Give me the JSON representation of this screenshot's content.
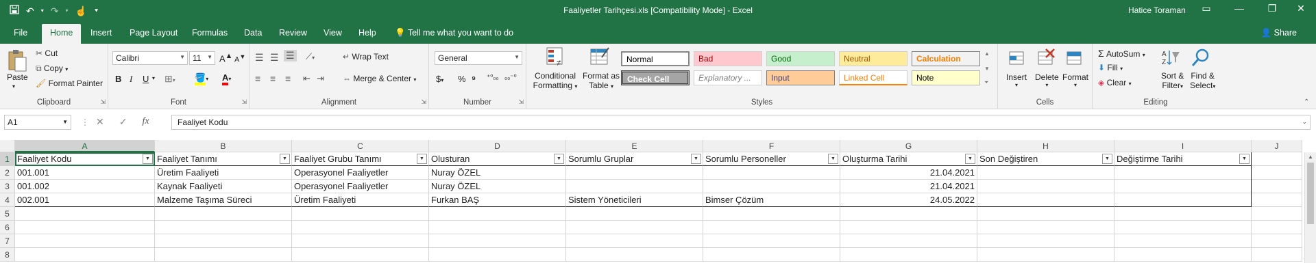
{
  "window": {
    "title": "Faaliyetler Tarihçesi.xls  [Compatibility Mode]  -  Excel",
    "user": "Hatice Toraman"
  },
  "tabs": [
    "File",
    "Home",
    "Insert",
    "Page Layout",
    "Formulas",
    "Data",
    "Review",
    "View",
    "Help"
  ],
  "tell_me": "Tell me what you want to do",
  "share": "Share",
  "clipboard": {
    "paste": "Paste",
    "cut": "Cut",
    "copy": "Copy",
    "format_painter": "Format Painter",
    "label": "Clipboard"
  },
  "font": {
    "name": "Calibri",
    "size": "11",
    "label": "Font"
  },
  "alignment": {
    "wrap": "Wrap Text",
    "merge": "Merge & Center",
    "label": "Alignment"
  },
  "number": {
    "format": "General",
    "label": "Number"
  },
  "styles": {
    "conditional": "Conditional",
    "conditional2": "Formatting",
    "format_as": "Format as",
    "format_as2": "Table",
    "label": "Styles",
    "items": [
      {
        "name": "Normal",
        "bg": "#ffffff",
        "color": "#000000"
      },
      {
        "name": "Bad",
        "bg": "#ffc7ce",
        "color": "#9c0006"
      },
      {
        "name": "Good",
        "bg": "#c6efce",
        "color": "#006100"
      },
      {
        "name": "Neutral",
        "bg": "#ffeb9c",
        "color": "#9c5700"
      },
      {
        "name": "Calculation",
        "bg": "#f2f2f2",
        "color": "#fa7d00"
      },
      {
        "name": "Check Cell",
        "bg": "#a5a5a5",
        "color": "#ffffff"
      },
      {
        "name": "Explanatory ...",
        "bg": "#ffffff",
        "color": "#7f7f7f"
      },
      {
        "name": "Input",
        "bg": "#ffcc99",
        "color": "#3f3f76"
      },
      {
        "name": "Linked Cell",
        "bg": "#ffffff",
        "color": "#fa7d00"
      },
      {
        "name": "Note",
        "bg": "#ffffcc",
        "color": "#000000"
      }
    ]
  },
  "cells_group": {
    "insert": "Insert",
    "delete": "Delete",
    "format": "Format",
    "label": "Cells"
  },
  "editing": {
    "autosum": "AutoSum",
    "fill": "Fill",
    "clear": "Clear",
    "sort": "Sort &",
    "sort2": "Filter",
    "find": "Find &",
    "find2": "Select",
    "label": "Editing"
  },
  "formula_bar": {
    "name_box": "A1",
    "value": "Faaliyet Kodu"
  },
  "columns": [
    "A",
    "B",
    "C",
    "D",
    "E",
    "F",
    "G",
    "H",
    "I",
    "J"
  ],
  "rows": [
    "1",
    "2",
    "3",
    "4",
    "5",
    "6",
    "7",
    "8"
  ],
  "table": {
    "headers": [
      "Faaliyet Kodu",
      "Faaliyet Tanımı",
      "Faaliyet Grubu Tanımı",
      "Olusturan",
      "Sorumlu Gruplar",
      "Sorumlu Personeller",
      "Oluşturma Tarihi",
      "Son Değiştiren",
      "Değiştirme Tarihi"
    ],
    "rows": [
      [
        "001.001",
        "Üretim Faaliyeti",
        "Operasyonel Faaliyetler",
        "Nuray ÖZEL",
        "",
        "",
        "21.04.2021",
        "",
        ""
      ],
      [
        "001.002",
        "Kaynak Faaliyeti",
        "Operasyonel Faaliyetler",
        "Nuray ÖZEL",
        "",
        "",
        "21.04.2021",
        "",
        ""
      ],
      [
        "002.001",
        "Malzeme Taşıma Süreci",
        "Üretim Faaliyeti",
        "Furkan BAŞ",
        "Sistem Yöneticileri",
        "Bimser Çözüm",
        "24.05.2022",
        "",
        ""
      ]
    ]
  }
}
